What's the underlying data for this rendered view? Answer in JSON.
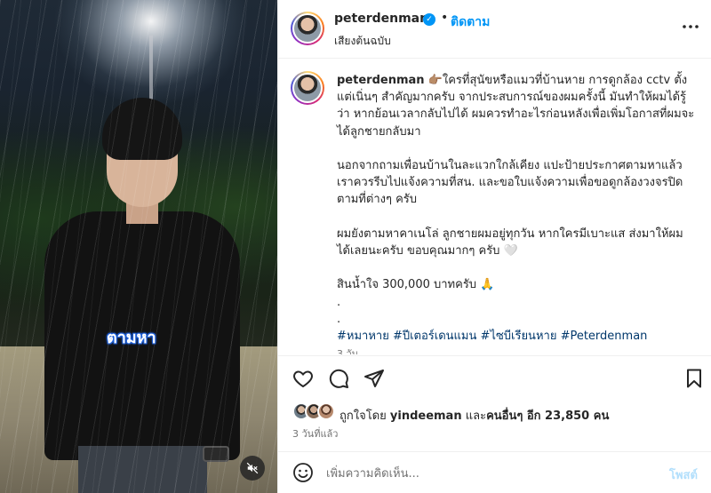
{
  "header": {
    "username": "peterdenman",
    "follow_label": "ติดตาม",
    "separator": "•",
    "audio": "เสียงต้นฉบับ"
  },
  "media": {
    "overlay_text": "ตามหา"
  },
  "caption": {
    "username": "peterdenman",
    "emoji": "👉🏽",
    "paragraph1": "ใครที่สุนัขหรือแมวที่บ้านหาย การดูกล้อง cctv ตั้งแต่เนิ่นๆ สำคัญมากครับ จากประสบการณ์ของผมครั้งนี้ มันทำให้ผมได้รู้ว่า หากย้อนเวลากลับไปได้ ผมควรทำอะไรก่อนหลังเพื่อเพิ่มโอกาสที่ผมจะได้ลูกชายกลับมา",
    "paragraph2": "นอกจากถามเพื่อนบ้านในละแวกใกล้เคียง แปะป้ายประกาศตามหาแล้ว เราควรรีบไปแจ้งความที่สน. และขอใบแจ้งความเพื่อขอดูกล้องวงจรปิดตามที่ต่างๆ ครับ",
    "paragraph3": "ผมยังตามหาคาเนโล่ ลูกชายผมอยู่ทุกวัน หากใครมีเบาะแส ส่งมาให้ผมได้เลยนะครับ ขอบคุณมากๆ ครับ 🤍",
    "reward": "สินน้ำใจ 300,000 บาทครับ 🙏",
    "dot1": ".",
    "dot2": ".",
    "hashtags": "#หมาหาย #ปีเตอร์เดนแมน #ไซบีเรียนหาย #Peterdenman",
    "time": "3 วัน"
  },
  "likes": {
    "prefix": "ถูกใจโดย",
    "user": "yindeeman",
    "middle": "และ",
    "others": "คนอื่นๆ อีก 23,850 คน"
  },
  "post_time": "3 วันที่แล้ว",
  "comment": {
    "placeholder": "เพิ่มความคิดเห็น...",
    "post_label": "โพสต์"
  },
  "colors": {
    "accent": "#0095f6",
    "hashtag": "#00376b",
    "post_disabled": "#b2dffc",
    "caption_overlay": "#1e5fd8"
  },
  "icons": {
    "like": "heart-icon",
    "comment": "comment-icon",
    "share": "send-icon",
    "save": "bookmark-icon",
    "more": "more-horizontal-icon",
    "mute": "speaker-muted-icon",
    "emoji": "emoji-icon",
    "verified": "verified-badge-icon"
  }
}
